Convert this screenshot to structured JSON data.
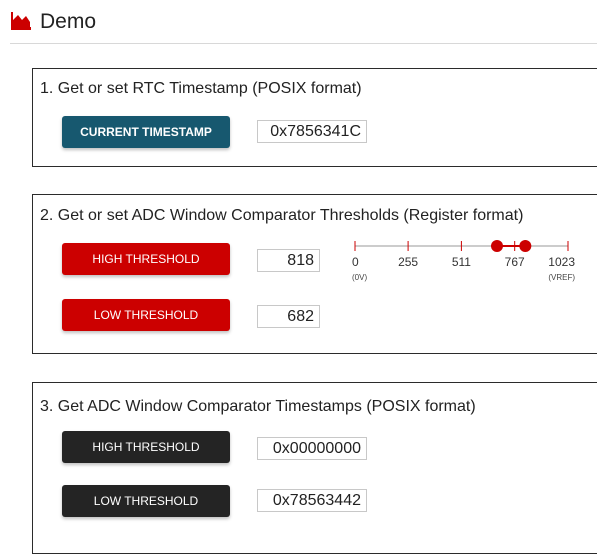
{
  "header": {
    "title": "Demo",
    "logo_icon": "chart-area-icon",
    "accent": "#cc0000"
  },
  "section1": {
    "title": "1. Get or set RTC Timestamp (POSIX format)",
    "button_label": "CURRENT TIMESTAMP",
    "value": "0x7856341C"
  },
  "section2": {
    "title": "2. Get or set ADC Window Comparator Thresholds (Register format)",
    "high_label": "HIGH THRESHOLD",
    "high_value": "818",
    "low_label": "LOW THRESHOLD",
    "low_value": "682",
    "slider": {
      "min": 0,
      "max": 1023,
      "low": 682,
      "high": 818,
      "ticks": [
        "0",
        "255",
        "511",
        "767",
        "1023"
      ],
      "tick_values": [
        0,
        255,
        511,
        767,
        1023
      ],
      "min_sub": "(0V)",
      "max_sub": "(VREF)"
    }
  },
  "section3": {
    "title": "3. Get ADC Window Comparator Timestamps (POSIX format)",
    "high_label": "HIGH THRESHOLD",
    "high_value": "0x00000000",
    "low_label": "LOW THRESHOLD",
    "low_value": "0x78563442"
  },
  "colors": {
    "teal": "#17586f",
    "red": "#cc0000",
    "dark": "#242424"
  }
}
